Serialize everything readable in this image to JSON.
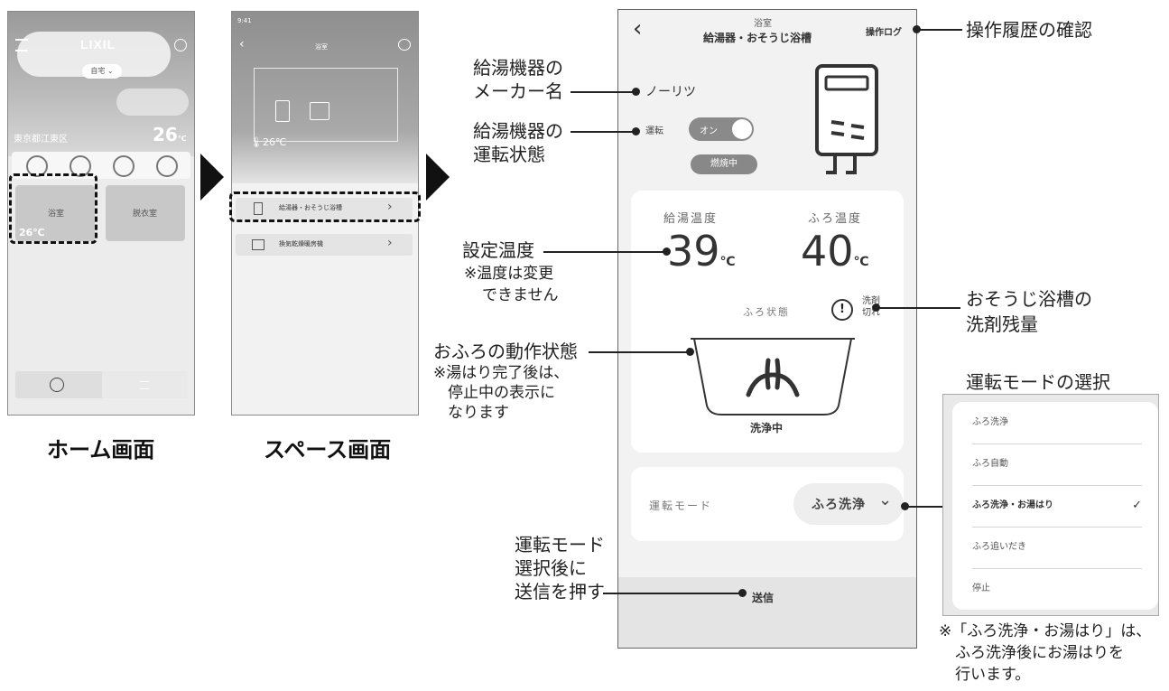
{
  "home": {
    "logo": "LIXIL",
    "location_pill": "自宅",
    "area": "東京都江東区",
    "temperature": "26",
    "temp_unit": "℃",
    "rooms": [
      {
        "name": "浴室",
        "temp": "26℃"
      },
      {
        "name": "脱衣室"
      }
    ],
    "caption": "ホーム画面"
  },
  "space": {
    "time": "9:41",
    "title": "浴室",
    "room_temp": "26℃",
    "devices": [
      "給湯器・おそうじ浴槽",
      "換気乾燥暖房機"
    ],
    "caption": "スペース画面"
  },
  "detail": {
    "subtitle": "浴室",
    "title": "給湯器・おそうじ浴槽",
    "log_button": "操作ログ",
    "maker": "ノーリツ",
    "run_label": "運転",
    "toggle_label": "オン",
    "burning_badge": "燃焼中",
    "hot_water_label": "給湯温度",
    "bath_label": "ふろ温度",
    "hot_water_temp": "39",
    "bath_temp": "40",
    "temp_unit": "℃",
    "bath_state_label": "ふろ状態",
    "detergent_warning": "洗剤切れ",
    "tub_status": "洗浄中",
    "mode_label": "運転モード",
    "mode_value": "ふろ洗浄",
    "send_button": "送信"
  },
  "callouts": {
    "log": "操作履歴の確認",
    "maker": [
      "給湯機器の",
      "メーカー名"
    ],
    "status": [
      "給湯機器の",
      "運転状態"
    ],
    "setting_temp": "設定温度",
    "setting_temp_note": [
      "※温度は変更",
      "できません"
    ],
    "bath_action": "おふろの動作状態",
    "bath_action_note": [
      "※湯はり完了後は、",
      "停止中の表示に",
      "なります"
    ],
    "detergent": [
      "おそうじ浴槽の",
      "洗剤残量"
    ],
    "send": [
      "運転モード",
      "選択後に",
      "送信を押す"
    ]
  },
  "mode_select": {
    "title": "運転モードの選択",
    "options": [
      "ふろ洗浄",
      "ふろ自動",
      "ふろ洗浄・お湯はり",
      "ふろ追いだき",
      "停止"
    ],
    "selected_index": 2,
    "note": [
      "※「ふろ洗浄・お湯はり」は、",
      "ふろ洗浄後にお湯はりを",
      "行います。"
    ]
  }
}
